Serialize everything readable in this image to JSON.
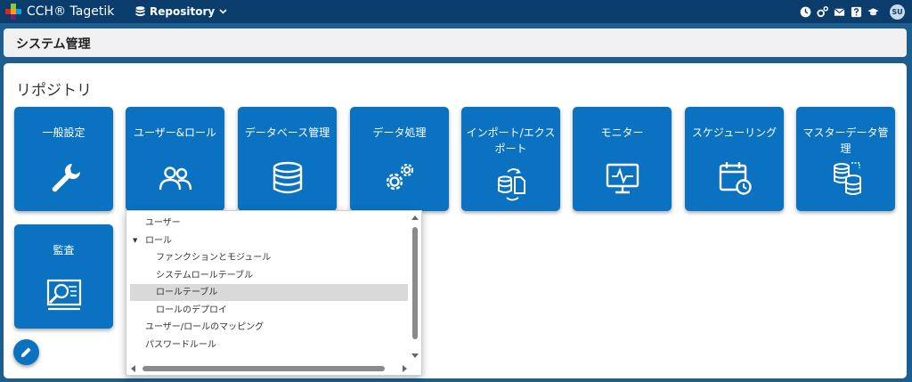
{
  "app": {
    "brand": "CCH® Tagetik",
    "repository_label": "Repository",
    "user_initials": "SU",
    "top_icons": [
      "clock-icon",
      "settings-icon",
      "mail-icon",
      "help-icon",
      "graduation-cap-icon"
    ]
  },
  "header": {
    "title": "システム管理"
  },
  "section": {
    "title": "リポジトリ"
  },
  "tiles": [
    {
      "label": "一般設定",
      "icon": "wrench-icon"
    },
    {
      "label": "ユーザー&ロール",
      "icon": "users-icon"
    },
    {
      "label": "データベース管理",
      "icon": "database-icon"
    },
    {
      "label": "データ処理",
      "icon": "gears-icon"
    },
    {
      "label": "インポート/エクスポート",
      "icon": "import-export-icon"
    },
    {
      "label": "モニター",
      "icon": "monitor-icon"
    },
    {
      "label": "スケジューリング",
      "icon": "calendar-clock-icon"
    },
    {
      "label": "マスターデータ管理",
      "icon": "master-data-icon"
    },
    {
      "label": "監査",
      "icon": "audit-icon"
    }
  ],
  "tree": {
    "items": [
      {
        "label": "ユーザー",
        "level": 0,
        "expanded": false,
        "selected": false
      },
      {
        "label": "ロール",
        "level": 0,
        "expanded": true,
        "selected": false
      },
      {
        "label": "ファンクションとモジュール",
        "level": 1,
        "selected": false
      },
      {
        "label": "システムロールテーブル",
        "level": 1,
        "selected": false
      },
      {
        "label": "ロールテーブル",
        "level": 1,
        "selected": true
      },
      {
        "label": "ロールのデプロイ",
        "level": 1,
        "selected": false
      },
      {
        "label": "ユーザー/ロールのマッピング",
        "level": 0,
        "selected": false
      },
      {
        "label": "パスワードルール",
        "level": 0,
        "selected": false
      }
    ]
  },
  "fab": {
    "icon": "pencil-icon"
  }
}
